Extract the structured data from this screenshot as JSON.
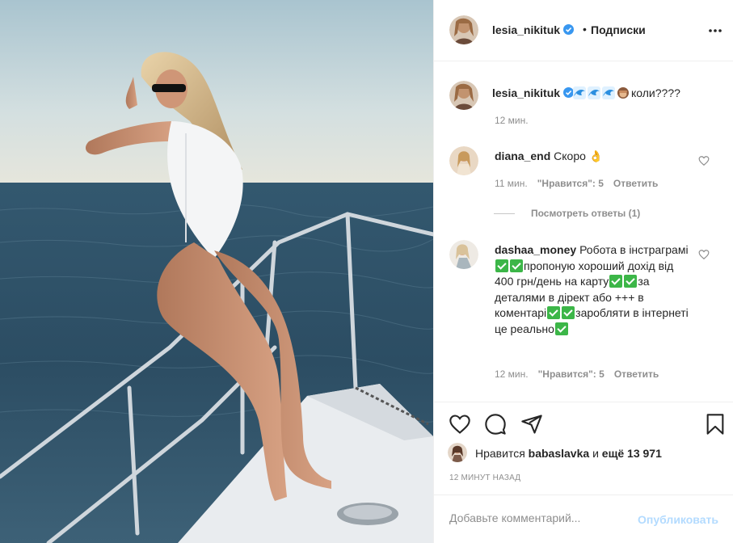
{
  "post": {
    "author": "lesia_nikituk",
    "follow_label": "Подписки",
    "dot": "•",
    "caption_text": "коли????",
    "caption_time": "12 мин."
  },
  "comments": [
    {
      "user": "diana_end",
      "text": "Скоро 👌",
      "time": "11 мин.",
      "likes": "\"Нравится\": 5",
      "reply": "Ответить"
    },
    {
      "user": "dashaa_money",
      "parts": [
        "Робота в інстраграмі",
        "пропоную хороший дохід від 400 грн/день на карту",
        "за деталями в дірект або +++ в коментарі",
        "заробляти в інтернеті це реально"
      ],
      "time": "12 мин.",
      "likes": "\"Нравится\": 5",
      "reply": "Ответить"
    }
  ],
  "view_replies": "Посмотреть ответы (1)",
  "likes": {
    "prefix": "Нравится",
    "user": "babaslavka",
    "mid": "и",
    "rest": "ещё 13 971"
  },
  "posted_ago": "12 МИНУТ НАЗАД",
  "add_comment": {
    "placeholder": "Добавьте комментарий...",
    "post_label": "Опубликовать"
  },
  "icons": [
    "verified-badge-icon",
    "more-options-icon",
    "heart-icon",
    "comment-icon",
    "share-icon",
    "bookmark-icon",
    "wave-emoji",
    "check-emoji"
  ],
  "colors": {
    "verified": "#3897f0",
    "post_disabled": "#b3dbff",
    "check": "#3cb648"
  }
}
